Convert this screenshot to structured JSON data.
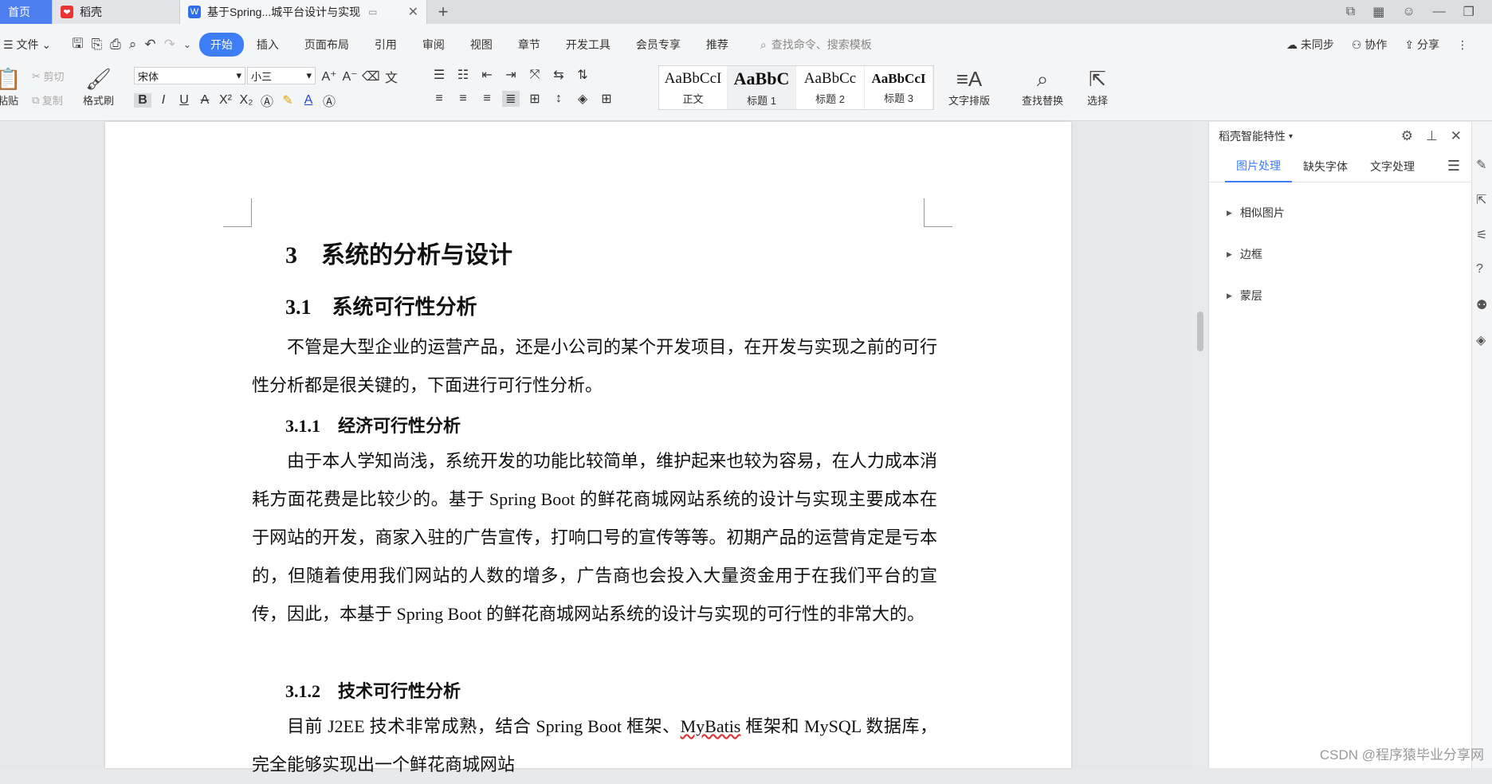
{
  "tabs": {
    "home": "首页",
    "daoke": "稻壳",
    "doc": "基于Spring...城平台设计与实现"
  },
  "menu": {
    "file": "文件",
    "items": [
      "开始",
      "插入",
      "页面布局",
      "引用",
      "审阅",
      "视图",
      "章节",
      "开发工具",
      "会员专享",
      "推荐"
    ],
    "search_placeholder": "查找命令、搜索模板",
    "sync": "未同步",
    "collab": "协作",
    "share": "分享"
  },
  "ribbon": {
    "paste": "粘贴",
    "cut": "剪切",
    "copy": "复制",
    "format_painter": "格式刷",
    "font_name": "宋体",
    "font_size": "小三",
    "styles": [
      {
        "sample": "AaBbCcI",
        "name": "正文"
      },
      {
        "sample": "AaBbC",
        "name": "标题 1"
      },
      {
        "sample": "AaBbCc",
        "name": "标题 2"
      },
      {
        "sample": "AaBbCcI",
        "name": "标题 3"
      }
    ],
    "text_layout": "文字排版",
    "find_replace": "查找替换",
    "select": "选择"
  },
  "document": {
    "h1": "3　系统的分析与设计",
    "h2": "3.1　系统可行性分析",
    "p1": "不管是大型企业的运营产品，还是小公司的某个开发项目，在开发与实现之前的可行性分析都是很关键的，下面进行可行性分析。",
    "h3a": "3.1.1　经济可行性分析",
    "p2": "由于本人学知尚浅，系统开发的功能比较简单，维护起来也较为容易，在人力成本消耗方面花费是比较少的。基于 Spring Boot 的鲜花商城网站系统的设计与实现主要成本在于网站的开发，商家入驻的广告宣传，打响口号的宣传等等。初期产品的运营肯定是亏本的，但随着使用我们网站的人数的增多，广告商也会投入大量资金用于在我们平台的宣传，因此，本基于 Spring Boot 的鲜花商城网站系统的设计与实现的可行性的非常大的。",
    "h3b": "3.1.2　技术可行性分析",
    "p3a": "目前 J2EE 技术非常成熟，结合 Spring Boot 框架、",
    "p3b": "MyBatis",
    "p3c": " 框架和 MySQL 数据库，完全能够实现出一个鲜花商城网站"
  },
  "pane": {
    "title": "稻壳智能特性",
    "tabs": [
      "图片处理",
      "缺失字体",
      "文字处理"
    ],
    "sections": [
      "相似图片",
      "边框",
      "蒙层"
    ]
  },
  "watermark": "CSDN @程序猿毕业分享网",
  "colors": {
    "accent": "#3d7ef6",
    "home_tab": "#4e7ff0"
  }
}
